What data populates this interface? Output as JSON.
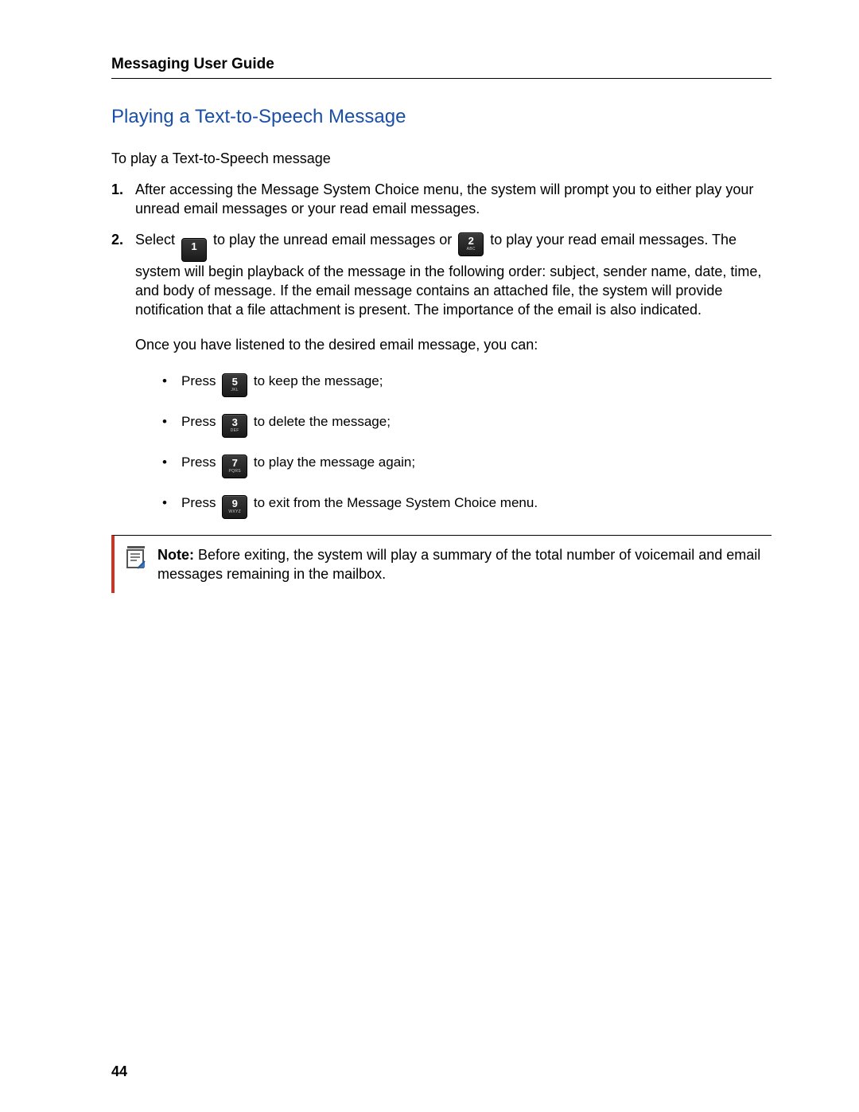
{
  "header": {
    "doc_title": "Messaging User Guide"
  },
  "section": {
    "title": "Playing a Text-to-Speech Message",
    "intro": "To play a Text-to-Speech message"
  },
  "steps": {
    "s1": {
      "num": "1.",
      "text": "After accessing the Message System Choice menu, the system will prompt you to either play your unread email messages or your read email messages."
    },
    "s2": {
      "num": "2.",
      "pre": "Select ",
      "key1_num": "1",
      "key1_sub": "",
      "mid1": " to play the unread email messages or ",
      "key2_num": "2",
      "key2_sub": "ABC",
      "mid2": " to play your read email messages. The system will begin playback of the message in the following order: subject, sender name, date, time, and body of message. If the email message contains an attached file, the system will provide notification that a file attachment is present. The importance of the email is also indicated."
    }
  },
  "after_listen": "Once you have listened to the desired email message, you can:",
  "actions": {
    "a1": {
      "pre": "Press ",
      "key_num": "5",
      "key_sub": "JKL",
      "post": " to keep the message;"
    },
    "a2": {
      "pre": "Press ",
      "key_num": "3",
      "key_sub": "DEF",
      "post": " to delete the message;"
    },
    "a3": {
      "pre": "Press ",
      "key_num": "7",
      "key_sub": "PQRS",
      "post": " to play the message again;"
    },
    "a4": {
      "pre": "Press ",
      "key_num": "9",
      "key_sub": "WXYZ",
      "post": " to exit from the Message System Choice menu."
    }
  },
  "note": {
    "label": "Note:",
    "text": " Before exiting, the system will play a summary of the total number of voicemail and email messages remaining in the mailbox."
  },
  "page_number": "44"
}
